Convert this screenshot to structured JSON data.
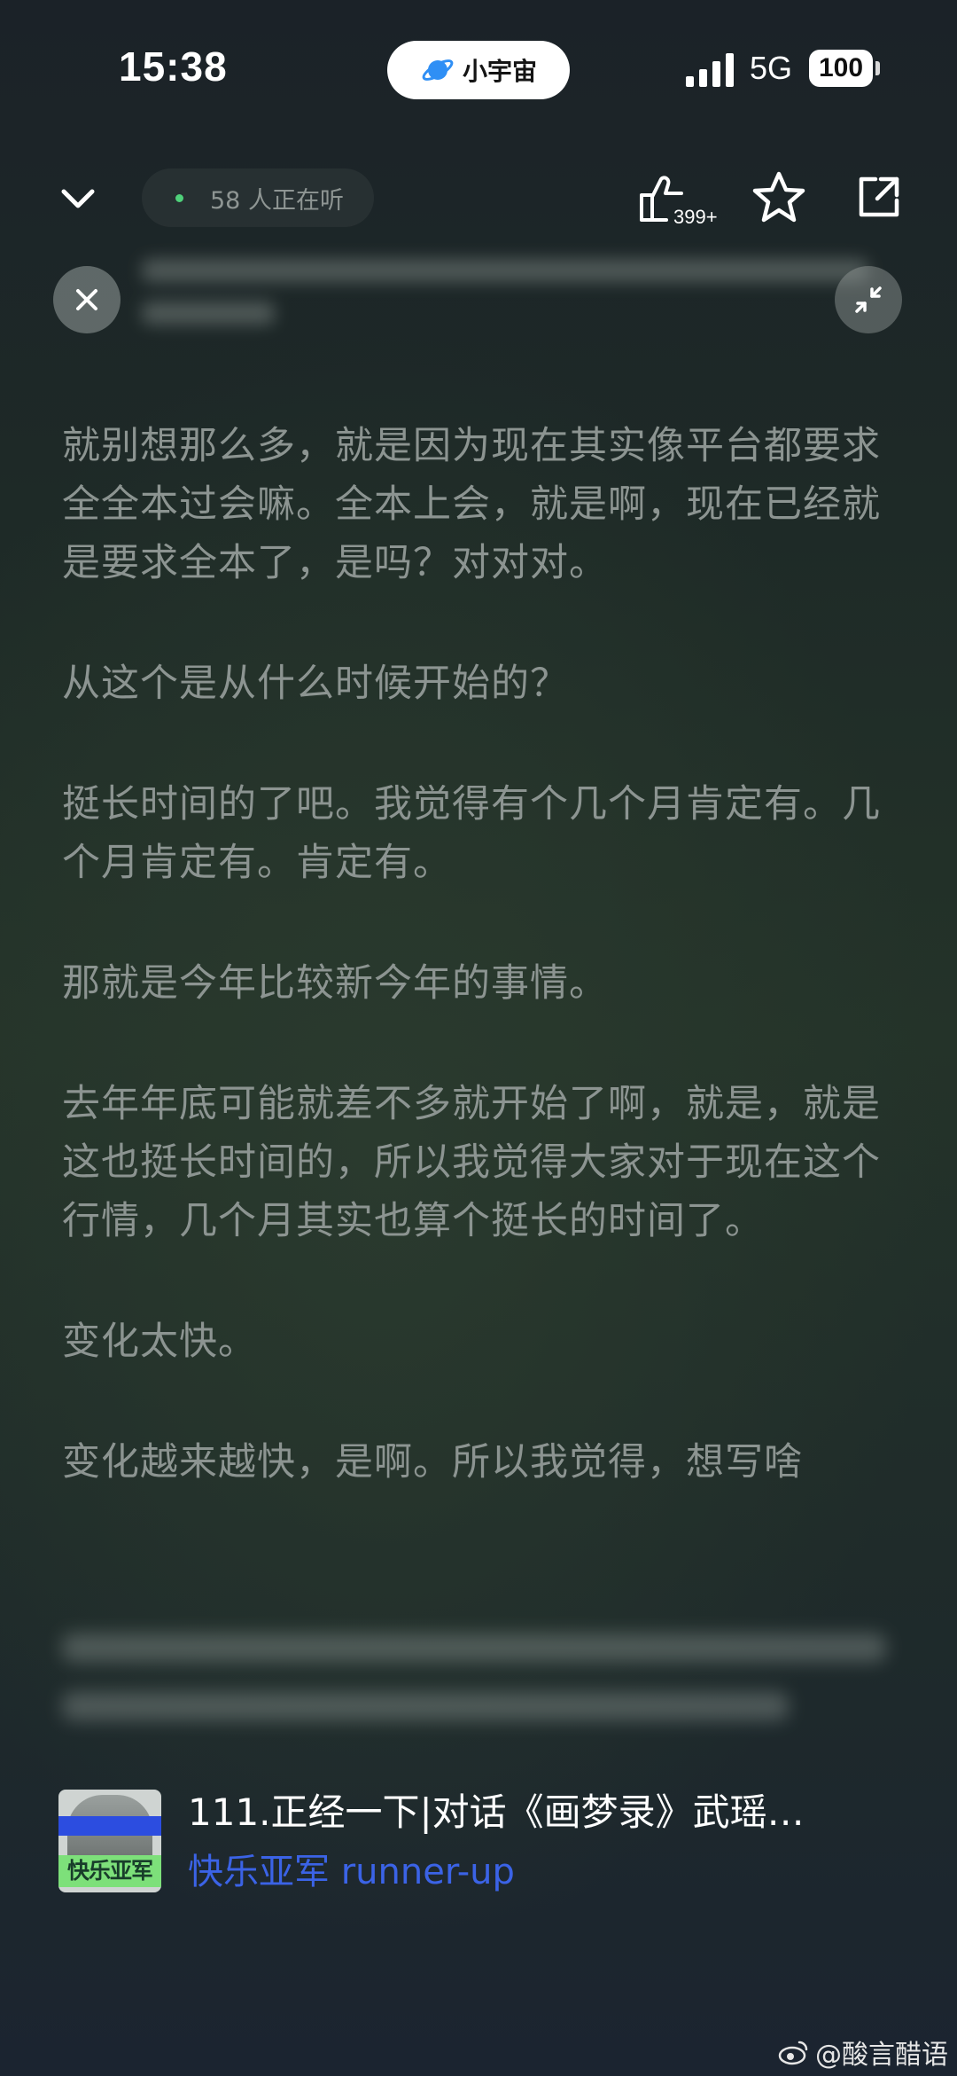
{
  "status_bar": {
    "time": "15:38",
    "app_name": "小宇宙",
    "network": "5G",
    "battery": "100"
  },
  "header": {
    "listeners": "58 人正在听",
    "like_count": "399+"
  },
  "transcript": {
    "paragraphs": [
      "就别想那么多，就是因为现在其实像平台都要求全全本过会嘛。全本上会，就是啊，现在已经就是要求全本了，是吗？对对对。",
      "从这个是从什么时候开始的？",
      "挺长时间的了吧。我觉得有个几个月肯定有。几个月肯定有。肯定有。",
      "那就是今年比较新今年的事情。",
      "去年年底可能就差不多就开始了啊，就是，就是这也挺长时间的，所以我觉得大家对于现在这个行情，几个月其实也算个挺长的时间了。",
      "变化太快。",
      "变化越来越快，是啊。所以我觉得，想写啥"
    ]
  },
  "episode": {
    "cover_label": "快乐亚军",
    "title": "111.正经一下|对话《画梦录》武瑶…",
    "podcast": "快乐亚军 runner-up"
  },
  "watermark": "@酸言醋语",
  "colors": {
    "accent_blue": "#3b63e6",
    "live_dot": "#4fd17a",
    "transcript_text": "#8c9491"
  }
}
